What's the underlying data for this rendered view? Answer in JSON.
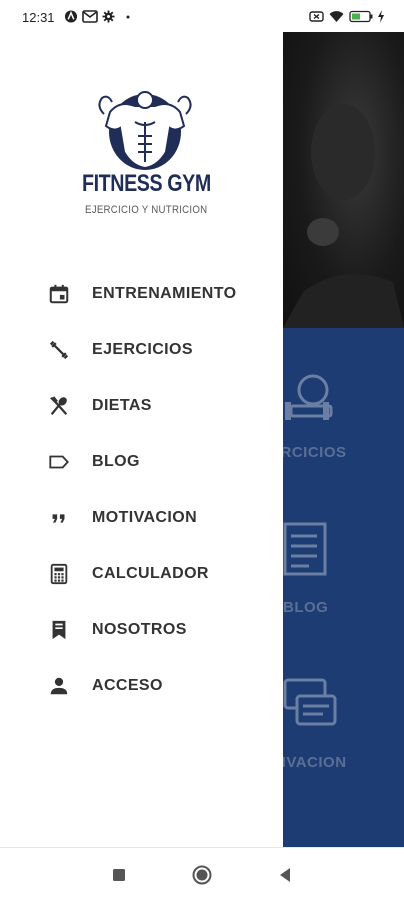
{
  "status_bar": {
    "time": "12:31",
    "icons": [
      "assistant-icon",
      "gmail-icon",
      "settings-icon",
      "dot-icon",
      "battery-saver-icon",
      "wifi-icon",
      "battery-icon",
      "charging-icon"
    ]
  },
  "brand": {
    "title": "FITNESS GYM",
    "subtitle": "EJERCICIO Y NUTRICION",
    "primary_color": "#1f2d57",
    "accent_color": "#1d3c74"
  },
  "menu": {
    "items": [
      {
        "label": "ENTRENAMIENTO",
        "icon": "calendar-icon"
      },
      {
        "label": "EJERCICIOS",
        "icon": "dumbbell-icon"
      },
      {
        "label": "DIETAS",
        "icon": "utensils-icon"
      },
      {
        "label": "BLOG",
        "icon": "label-tag-icon"
      },
      {
        "label": "MOTIVACION",
        "icon": "quote-icon"
      },
      {
        "label": "CALCULADOR",
        "icon": "calculator-icon"
      },
      {
        "label": "NOSOTROS",
        "icon": "bookmark-icon"
      },
      {
        "label": "ACCESO",
        "icon": "person-icon"
      }
    ]
  },
  "background": {
    "labels": [
      "ERCICIOS",
      "BLOG",
      "TIVACION"
    ]
  },
  "nav_bar": {
    "buttons": [
      "recents-button",
      "home-button",
      "back-button"
    ]
  }
}
